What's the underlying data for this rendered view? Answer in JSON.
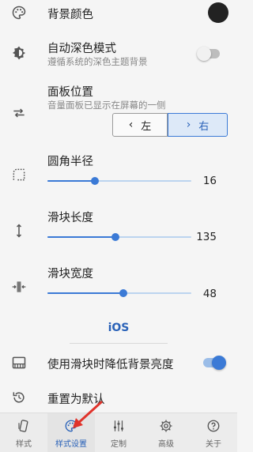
{
  "background_color": {
    "title": "背景颜色",
    "swatch": "#222222"
  },
  "auto_dark": {
    "title": "自动深色模式",
    "subtitle": "遵循系统的深色主题背景",
    "enabled": false
  },
  "panel_position": {
    "title": "面板位置",
    "subtitle": "音量面板已显示在屏幕的一侧",
    "left_label": "左",
    "right_label": "右",
    "selected": "右"
  },
  "corner_radius": {
    "title": "圆角半径",
    "value": "16",
    "fraction": 0.33
  },
  "slider_length": {
    "title": "滑块长度",
    "value": "135",
    "fraction": 0.47
  },
  "slider_width": {
    "title": "滑块宽度",
    "value": "48",
    "fraction": 0.53
  },
  "style_header": "iOS",
  "dim_background": {
    "title": "使用滑块时降低背景亮度",
    "enabled": true
  },
  "reset": {
    "title": "重置为默认"
  },
  "bottom_nav": [
    {
      "label": "样式",
      "icon": "style-icon"
    },
    {
      "label": "样式设置",
      "icon": "palette-icon",
      "active": true
    },
    {
      "label": "定制",
      "icon": "sliders-icon"
    },
    {
      "label": "高级",
      "icon": "gear-icon"
    },
    {
      "label": "关于",
      "icon": "help-icon"
    }
  ],
  "colors": {
    "accent": "#3b7ad6",
    "track": "#bcd4ef",
    "annotation_arrow": "#e0332b"
  }
}
